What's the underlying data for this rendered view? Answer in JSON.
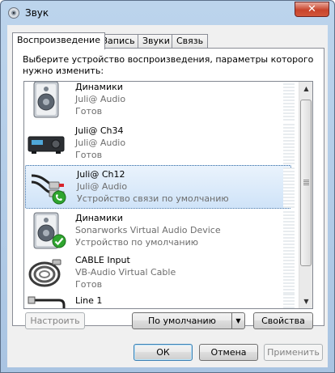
{
  "window": {
    "title": "Звук",
    "close_label": "✕"
  },
  "tabs": [
    {
      "label": "Воспроизведение"
    },
    {
      "label": "Запись"
    },
    {
      "label": "Звуки"
    },
    {
      "label": "Связь"
    }
  ],
  "description": "Выберите устройство воспроизведения, параметры которого нужно изменить:",
  "devices": [
    {
      "name": "Динамики",
      "line2": "Juli@ Audio",
      "line3": "Готов",
      "icon": "speaker-icon",
      "status_icon": "",
      "selected": false
    },
    {
      "name": "Juli@ Ch34",
      "line2": "Juli@ Audio",
      "line3": "Готов",
      "icon": "receiver-icon",
      "status_icon": "",
      "selected": false
    },
    {
      "name": "Juli@ Ch12",
      "line2": "Juli@ Audio",
      "line3": "Устройство связи по умолчанию",
      "icon": "rca-cable-icon",
      "status_icon": "phone-badge-icon",
      "selected": true
    },
    {
      "name": "Динамики",
      "line2": "Sonarworks Virtual Audio Device",
      "line3": "Устройство по умолчанию",
      "icon": "speaker-icon",
      "status_icon": "check-badge-icon",
      "selected": false
    },
    {
      "name": "CABLE Input",
      "line2": "VB-Audio Virtual Cable",
      "line3": "Готов",
      "icon": "cable-coil-icon",
      "status_icon": "",
      "selected": false
    },
    {
      "name": "Line 1",
      "line2": "",
      "line3": "",
      "icon": "line-cable-icon",
      "status_icon": "",
      "selected": false
    }
  ],
  "buttons": {
    "configure": "Настроить",
    "set_default": "По умолчанию",
    "properties": "Свойства",
    "ok": "ОК",
    "cancel": "Отмена",
    "apply": "Применить"
  },
  "colors": {
    "title_bar": "#bcd4ec",
    "selection": "#cfe3f8",
    "check_green": "#2fa52f"
  }
}
